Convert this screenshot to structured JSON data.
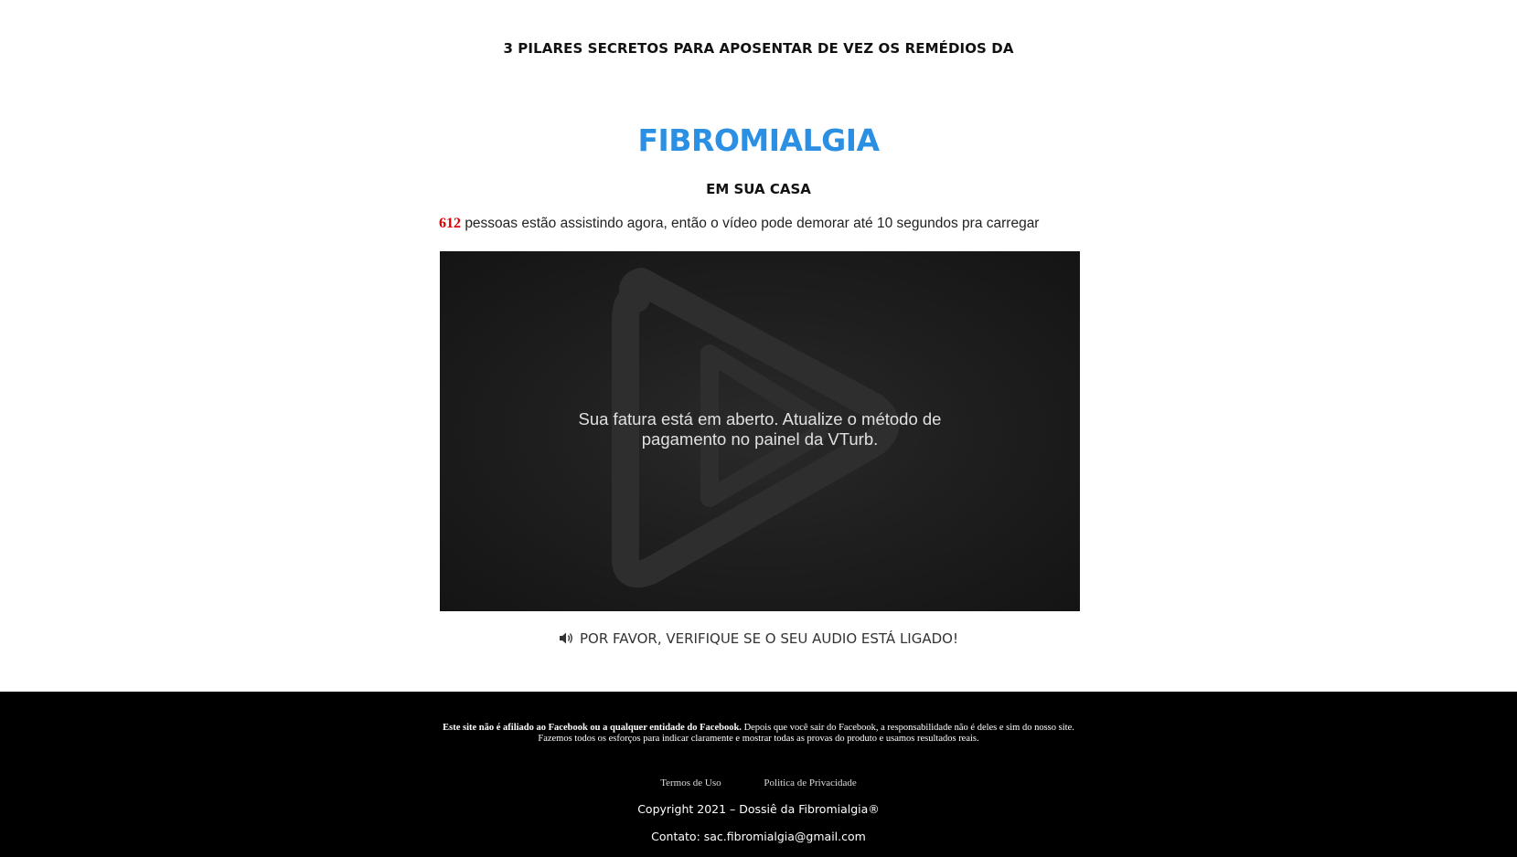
{
  "header": {
    "top_heading": "3 PILARES SECRETOS PARA APOSENTAR DE VEZ OS REMÉDIOS DA",
    "main_title": "FIBROMIALGIA",
    "sub_title": "EM SUA CASA"
  },
  "viewers": {
    "count": "612",
    "text": "pessoas estão assistindo agora, então o vídeo pode demorar até 10 segundos pra carregar"
  },
  "video": {
    "message_line1": "Sua fatura está em aberto. Atualize o método de",
    "message_line2": "pagamento no painel da VTurb.",
    "logo_icon": "play-logo-icon"
  },
  "audio_notice": {
    "icon": "speaker-icon",
    "text": "POR FAVOR, VERIFIQUE SE O SEU AUDIO ESTÁ LIGADO!"
  },
  "footer": {
    "disclaimer_bold": "Este site não é afiliado ao Facebook ou a qualquer entidade do Facebook.",
    "disclaimer_rest": " Depois que você sair do Facebook, a responsabilidade não é deles e sim do nosso site.",
    "disclaimer_line2": "Fazemos todos os esforços para indicar claramente e mostrar todas as provas do produto e usamos resultados reais.",
    "terms_link": "Termos de Uso",
    "privacy_link": "Politica de Privacidade",
    "copyright": "Copyright 2021 – Dossiê da Fibromialgia®",
    "contact": "Contato: sac.fibromialgia@gmail.com"
  },
  "colors": {
    "accent_blue": "#2b8fe3",
    "count_red": "#e10000",
    "footer_bg": "#000000"
  }
}
